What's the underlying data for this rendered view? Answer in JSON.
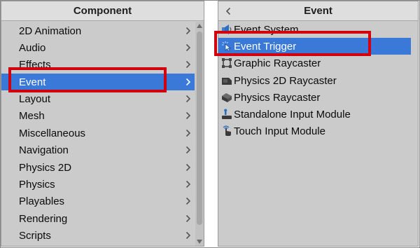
{
  "left_menu": {
    "title": "Component",
    "items": [
      {
        "label": "2D Animation"
      },
      {
        "label": "Audio"
      },
      {
        "label": "Effects"
      },
      {
        "label": "Event"
      },
      {
        "label": "Layout"
      },
      {
        "label": "Mesh"
      },
      {
        "label": "Miscellaneous"
      },
      {
        "label": "Navigation"
      },
      {
        "label": "Physics 2D"
      },
      {
        "label": "Physics"
      },
      {
        "label": "Playables"
      },
      {
        "label": "Rendering"
      },
      {
        "label": "Scripts"
      }
    ],
    "selected_item": "Event"
  },
  "right_menu": {
    "title": "Event",
    "items": [
      {
        "label": "Event System",
        "icon": "event-system-icon"
      },
      {
        "label": "Event Trigger",
        "icon": "event-trigger-icon"
      },
      {
        "label": "Graphic Raycaster",
        "icon": "graphic-raycaster-icon"
      },
      {
        "label": "Physics 2D Raycaster",
        "icon": "physics-2d-raycaster-icon"
      },
      {
        "label": "Physics Raycaster",
        "icon": "physics-raycaster-icon"
      },
      {
        "label": "Standalone Input Module",
        "icon": "standalone-input-module-icon"
      },
      {
        "label": "Touch Input Module",
        "icon": "touch-input-module-icon"
      }
    ],
    "selected_item": "Event Trigger"
  },
  "colors": {
    "selection": "#3a79d8",
    "highlight_box": "#d2000f",
    "panel_bg": "#cbcbcb",
    "header_bg": "#dedede"
  }
}
